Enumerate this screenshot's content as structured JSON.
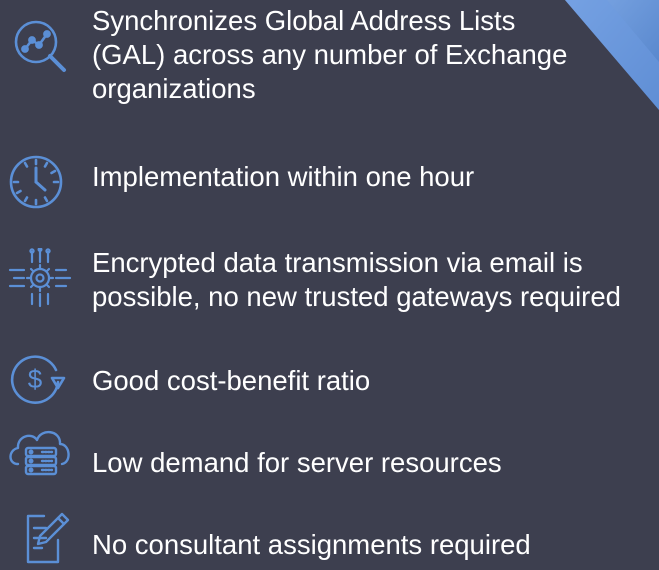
{
  "accent_color": "#5b8fd6",
  "background_color": "#3d3f4f",
  "features": [
    {
      "icon": "magnifier-chart-icon",
      "lines": [
        "Synchronizes Global Address Lists",
        "(GAL) across any number of Exchange",
        "organizations"
      ]
    },
    {
      "icon": "clock-icon",
      "lines": [
        "Implementation within one hour"
      ]
    },
    {
      "icon": "gear-circuit-icon",
      "lines": [
        "Encrypted data transmission via email is",
        "possible, no new trusted gateways required"
      ]
    },
    {
      "icon": "dollar-down-icon",
      "lines": [
        "Good cost-benefit ratio"
      ]
    },
    {
      "icon": "cloud-server-icon",
      "lines": [
        "Low demand for server resources"
      ]
    },
    {
      "icon": "document-pen-icon",
      "lines": [
        "No consultant assignments required"
      ]
    }
  ]
}
